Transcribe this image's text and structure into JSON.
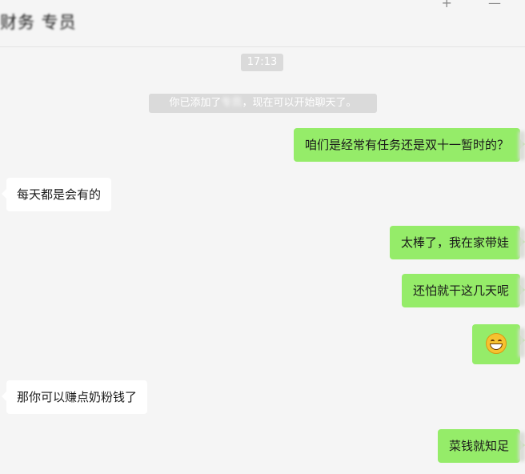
{
  "header": {
    "contact_name": "财务 专员",
    "actions": "+ —"
  },
  "timestamp": "17:13",
  "system_notice": {
    "prefix": "你已添加了",
    "name": "专员",
    "suffix": "，现在可以开始聊天了。"
  },
  "messages": [
    {
      "direction": "out",
      "text": "咱们是经常有任务还是双十一暂时的？"
    },
    {
      "direction": "in",
      "text": "每天都是会有的"
    },
    {
      "direction": "out",
      "text": "太棒了，我在家带娃"
    },
    {
      "direction": "out",
      "text": "还怕就干这几天呢"
    },
    {
      "direction": "out",
      "emoji": "grin-emoji"
    },
    {
      "direction": "in",
      "text": "那你可以赚点奶粉钱了"
    },
    {
      "direction": "out",
      "text": "菜钱就知足"
    }
  ],
  "colors": {
    "outgoing_bubble": "#95ec69",
    "incoming_bubble": "#ffffff",
    "background": "#f5f5f5",
    "notice_bg": "#dadada"
  }
}
